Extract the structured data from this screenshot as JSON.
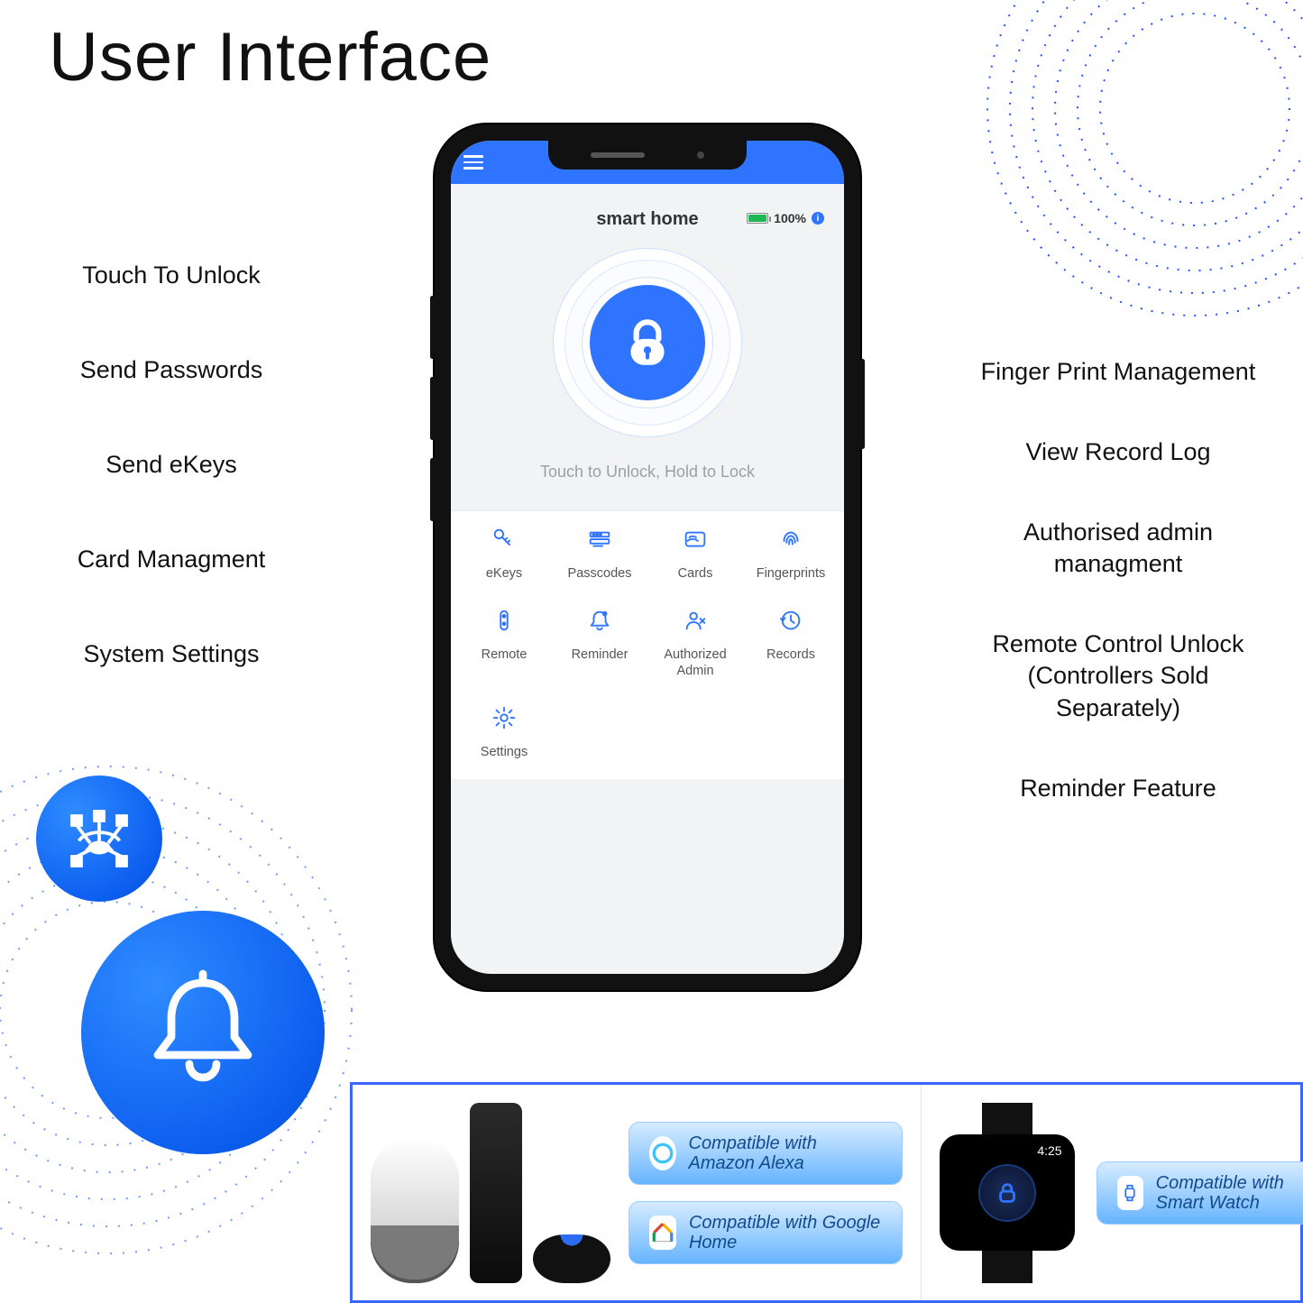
{
  "page": {
    "title": "User Interface"
  },
  "features_left": [
    "Touch To Unlock",
    "Send Passwords",
    "Send eKeys",
    "Card Managment",
    "System Settings"
  ],
  "features_right": [
    "Finger Print Management",
    "View Record Log",
    "Authorised admin managment",
    "Remote Control Unlock (Controllers Sold Separately)",
    "Reminder Feature"
  ],
  "phone": {
    "device_name": "smart home",
    "battery_percent": "100%",
    "lock_hint": "Touch to Unlock, Hold to Lock",
    "grid": [
      {
        "label": "eKeys",
        "icon": "keys-icon"
      },
      {
        "label": "Passcodes",
        "icon": "passcode-icon"
      },
      {
        "label": "Cards",
        "icon": "card-icon"
      },
      {
        "label": "Fingerprints",
        "icon": "fingerprint-icon"
      },
      {
        "label": "Remote",
        "icon": "remote-icon"
      },
      {
        "label": "Reminder",
        "icon": "reminder-bell-icon"
      },
      {
        "label": "Authorized Admin",
        "icon": "admin-icon"
      },
      {
        "label": "Records",
        "icon": "records-icon"
      },
      {
        "label": "Settings",
        "icon": "settings-gear-icon"
      }
    ]
  },
  "compat": {
    "alexa": "Compatible with Amazon Alexa",
    "google": "Compatible with Google Home",
    "watch": "Compatible with Smart Watch",
    "watch_time": "4:25"
  },
  "colors": {
    "accent": "#2f74ff"
  }
}
